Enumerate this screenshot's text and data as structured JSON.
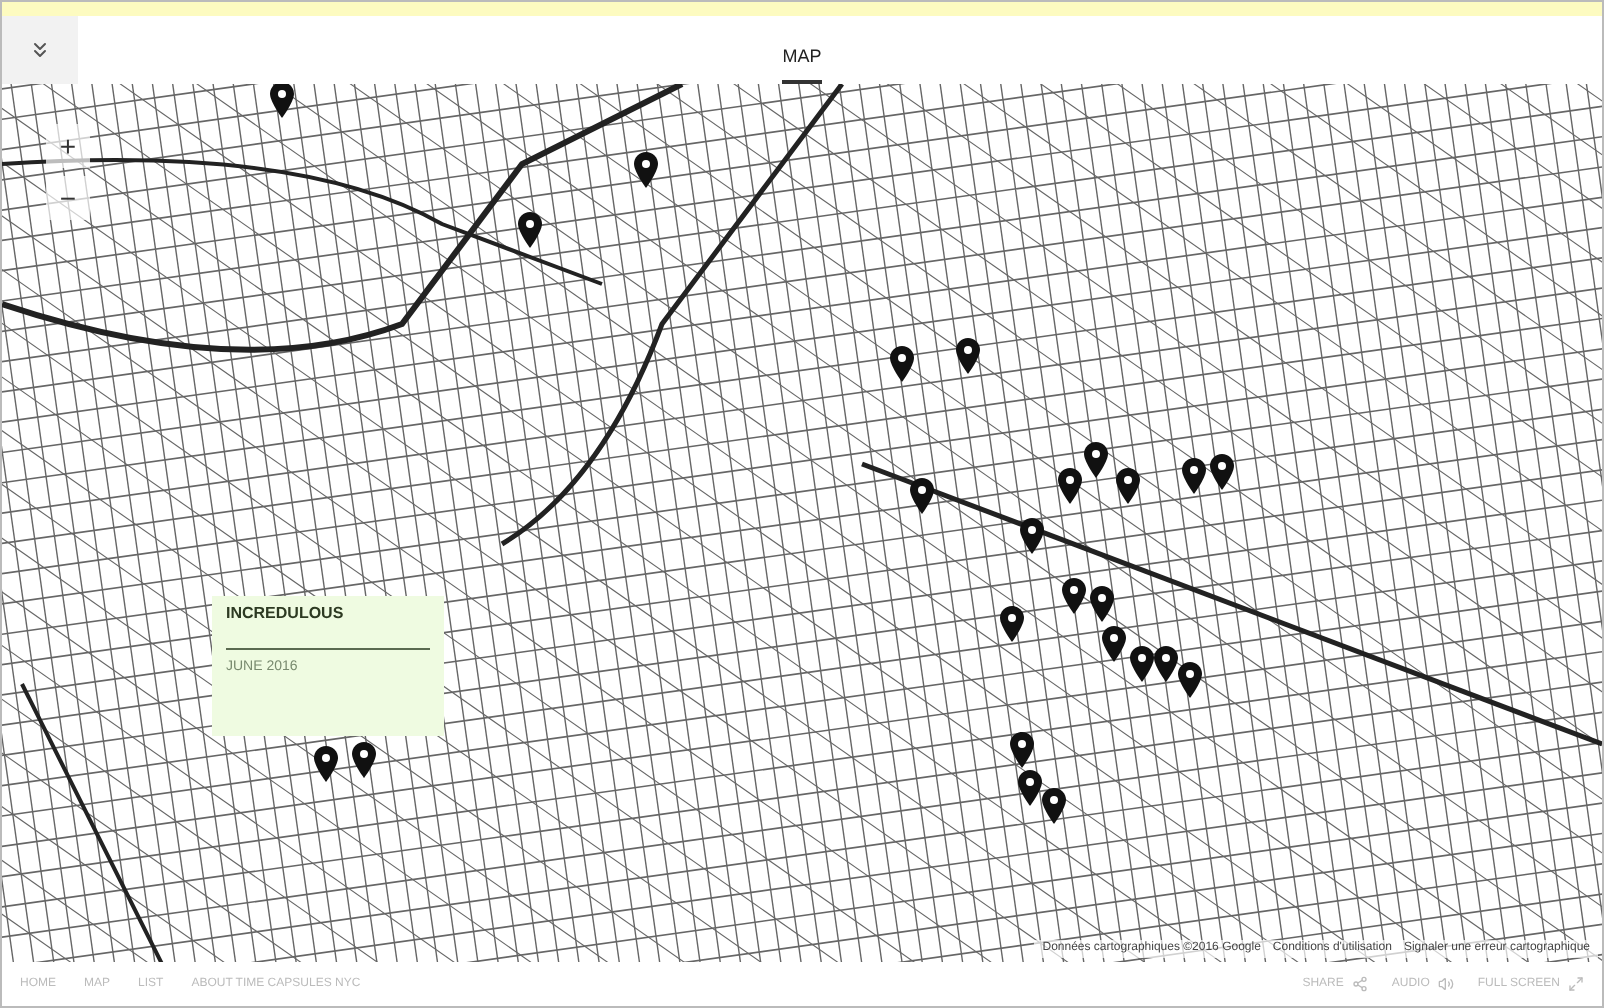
{
  "header": {
    "tabs": [
      {
        "label": "MAP",
        "selected": true
      }
    ]
  },
  "map": {
    "zoom_in": "+",
    "zoom_out": "−",
    "attribution": [
      "Données cartographiques ©2016 Google",
      "Conditions d'utilisation",
      "Signaler une erreur cartographique"
    ]
  },
  "popup": {
    "title": "INCREDULOUS",
    "date": "JUNE 2016"
  },
  "footer": {
    "nav": [
      "HOME",
      "MAP",
      "LIST",
      "ABOUT TIME CAPSULES NYC"
    ],
    "actions": [
      {
        "label": "SHARE",
        "kind": "share"
      },
      {
        "label": "AUDIO",
        "kind": "audio"
      },
      {
        "label": "FULL SCREEN",
        "kind": "fullscreen"
      }
    ]
  }
}
